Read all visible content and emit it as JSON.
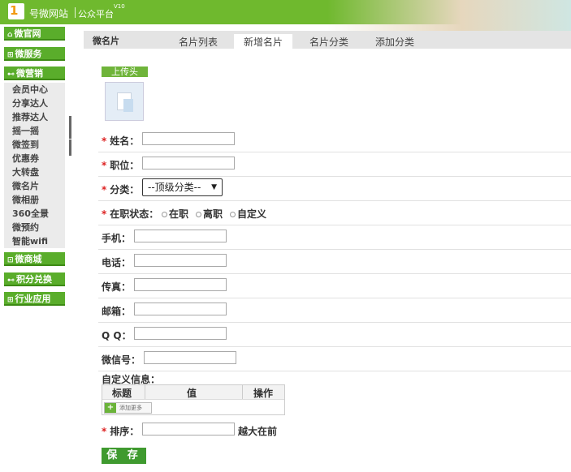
{
  "header": {
    "logo_num": "1",
    "site_name": "号微网站",
    "platform": "公众平台",
    "version": "V10"
  },
  "sidebar": {
    "groups": [
      {
        "label": "微官网",
        "icon": "home-icon"
      },
      {
        "label": "微服务",
        "icon": "grid-icon"
      },
      {
        "label": "微营销",
        "icon": "share-icon"
      },
      {
        "label": "微商城",
        "icon": "cart-icon"
      },
      {
        "label": "积分兑换",
        "icon": "gift-icon"
      },
      {
        "label": "行业应用",
        "icon": "grid-icon"
      }
    ],
    "marketing_items": [
      "会员中心",
      "分享达人",
      "推荐达人",
      "摇一摇",
      "微签到",
      "优惠券",
      "大转盘",
      "微名片",
      "微相册",
      "360全景",
      "微预约",
      "智能wifi"
    ]
  },
  "tabs": {
    "title": "微名片",
    "items": [
      "名片列表",
      "新增名片",
      "名片分类",
      "添加分类"
    ],
    "active": "新增名片"
  },
  "form": {
    "upload_label": "上传头",
    "required_mark": "*",
    "name_label": "姓名：",
    "position_label": "职位：",
    "category_label": "分类：",
    "category_value": "--顶级分类--",
    "status_label": "在职状态：",
    "status_options": [
      "在职",
      "离职",
      "自定义"
    ],
    "mobile_label": "手机：",
    "phone_label": "电话：",
    "fax_label": "传真：",
    "email_label": "邮箱：",
    "qq_label": "Q Q：",
    "wechat_label": "微信号：",
    "custom_info_label": "自定义信息：",
    "custom_table_headers": [
      "标题",
      "值",
      "操作"
    ],
    "add_more_label": "添加更多",
    "sort_label": "排序：",
    "sort_hint": "越大在前",
    "save_label": "保 存"
  }
}
